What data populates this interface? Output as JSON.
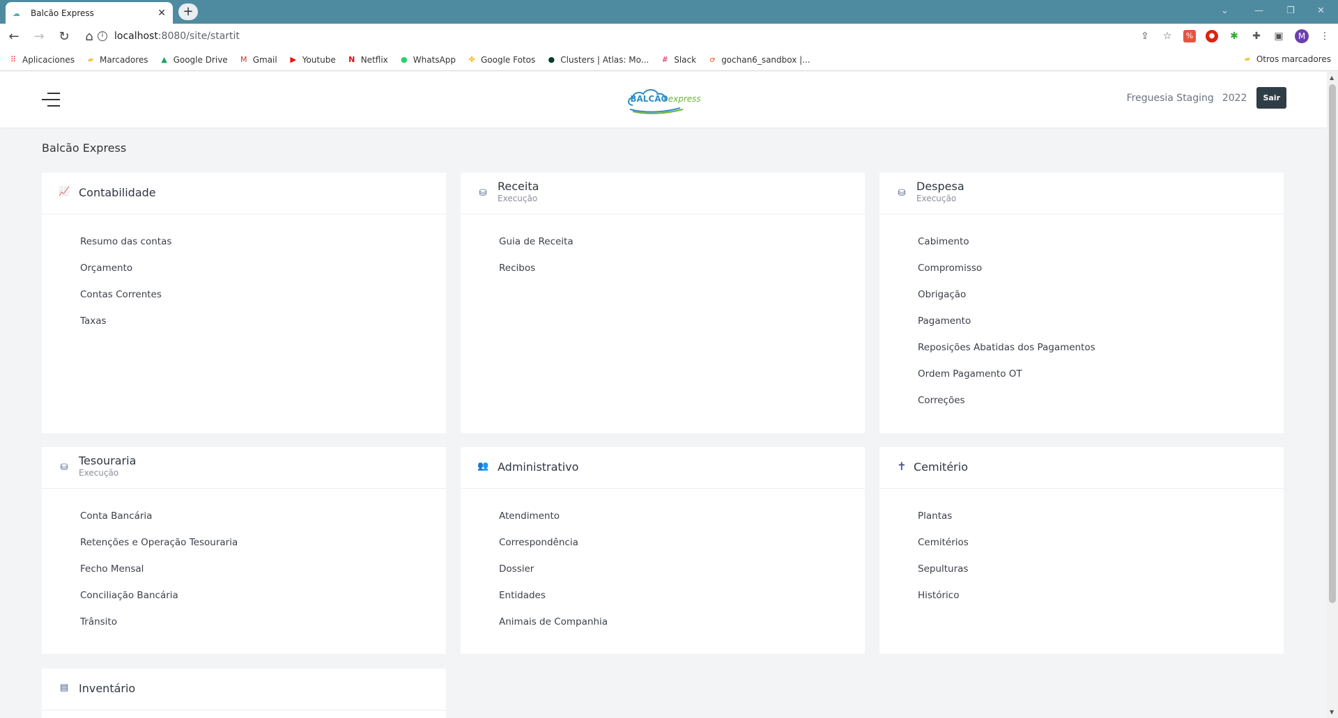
{
  "browser": {
    "tab_title": "Balcão Express",
    "url_host": "localhost",
    "url_path": ":8080/site/startit",
    "bookmarks": [
      "Aplicaciones",
      "Marcadores",
      "Google Drive",
      "Gmail",
      "Youtube",
      "Netflix",
      "WhatsApp",
      "Google Fotos",
      "Clusters | Atlas: Mo...",
      "Slack",
      "gochan6_sandbox |..."
    ],
    "bookmark_icons": [
      "apps-grid-icon",
      "folder-icon",
      "google-drive-icon",
      "gmail-icon",
      "youtube-icon",
      "netflix-icon",
      "whatsapp-icon",
      "google-photos-icon",
      "mongodb-icon",
      "slack-icon",
      "postman-icon"
    ],
    "other_bookmarks": "Otros marcadores",
    "avatar_letter": "M"
  },
  "header": {
    "logo_main": "BALCÃO",
    "logo_sub": "express",
    "entity": "Freguesia Staging",
    "year": "2022",
    "logout_label": "Sair"
  },
  "page_title": "Balcão Express",
  "cards": [
    {
      "title": "Contabilidade",
      "subtitle": "",
      "icon": "chart-line-icon",
      "items": [
        "Resumo das contas",
        "Orçamento",
        "Contas Correntes",
        "Taxas"
      ]
    },
    {
      "title": "Receita",
      "subtitle": "Execução",
      "icon": "coins-icon",
      "items": [
        "Guia de Receita",
        "Recibos"
      ]
    },
    {
      "title": "Despesa",
      "subtitle": "Execução",
      "icon": "coins-icon",
      "items": [
        "Cabimento",
        "Compromisso",
        "Obrigação",
        "Pagamento",
        "Reposições Abatidas dos Pagamentos",
        "Ordem Pagamento OT",
        "Correções"
      ]
    },
    {
      "title": "Tesouraria",
      "subtitle": "Execução",
      "icon": "coins-icon",
      "items": [
        "Conta Bancária",
        "Retenções e Operação Tesouraria",
        "Fecho Mensal",
        "Conciliação Bancária",
        "Trânsito"
      ]
    },
    {
      "title": "Administrativo",
      "subtitle": "",
      "icon": "users-icon",
      "items": [
        "Atendimento",
        "Correspondência",
        "Dossier",
        "Entidades",
        "Animais de Companhia"
      ]
    },
    {
      "title": "Cemitério",
      "subtitle": "",
      "icon": "cross-icon",
      "items": [
        "Plantas",
        "Cemitérios",
        "Sepulturas",
        "Histórico"
      ]
    },
    {
      "title": "Inventário",
      "subtitle": "",
      "icon": "list-icon",
      "items": []
    }
  ]
}
